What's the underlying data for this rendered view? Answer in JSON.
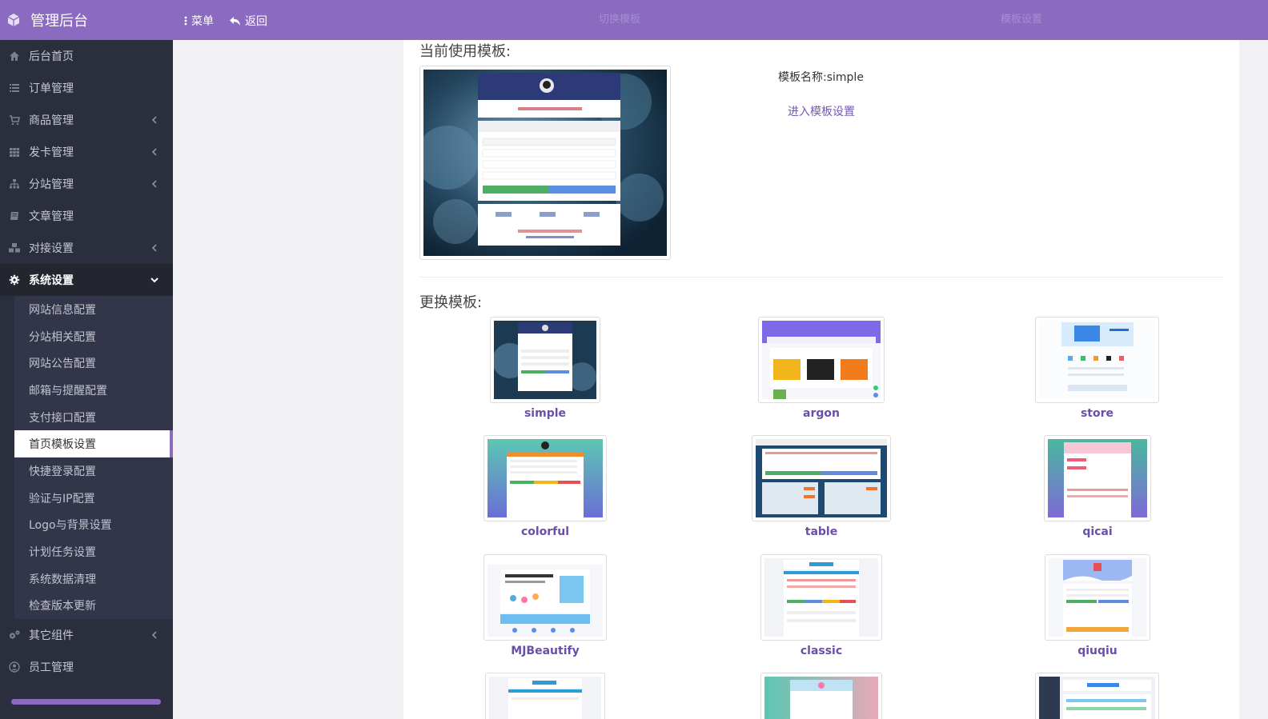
{
  "brand": {
    "title": "管理后台"
  },
  "topbar": {
    "menu_label": "菜单",
    "back_label": "返回",
    "tab_switch": "切换模板",
    "tab_settings": "模板设置"
  },
  "sidebar": {
    "items": [
      {
        "label": "后台首页",
        "icon": "home-icon"
      },
      {
        "label": "订单管理",
        "icon": "list-icon"
      },
      {
        "label": "商品管理",
        "icon": "cart-icon"
      },
      {
        "label": "发卡管理",
        "icon": "grid-icon"
      },
      {
        "label": "分站管理",
        "icon": "sitemap-icon"
      },
      {
        "label": "文章管理",
        "icon": "book-icon"
      },
      {
        "label": "对接设置",
        "icon": "cubes-icon"
      },
      {
        "label": "系统设置",
        "icon": "gear-icon"
      }
    ],
    "system_sub": [
      "网站信息配置",
      "分站相关配置",
      "网站公告配置",
      "邮箱与提醒配置",
      "支付接口配置",
      "首页模板设置",
      "快捷登录配置",
      "验证与IP配置",
      "Logo与背景设置",
      "计划任务设置",
      "系统数据清理",
      "检查版本更新"
    ],
    "bottom_items": [
      {
        "label": "其它组件",
        "icon": "gears-icon"
      },
      {
        "label": "员工管理",
        "icon": "user-icon"
      }
    ]
  },
  "content": {
    "current_title": "当前使用模板:",
    "template_name_text": "模板名称:simple",
    "settings_link": "进入模板设置",
    "change_title": "更换模板:",
    "templates": [
      "simple",
      "argon",
      "store",
      "colorful",
      "table",
      "qicai",
      "MJBeautify",
      "classic",
      "qiuqiu"
    ]
  },
  "colors": {
    "accent": "#8a6bbf",
    "sidebar_bg": "#2b2e3d",
    "link": "#6b4ea9"
  }
}
